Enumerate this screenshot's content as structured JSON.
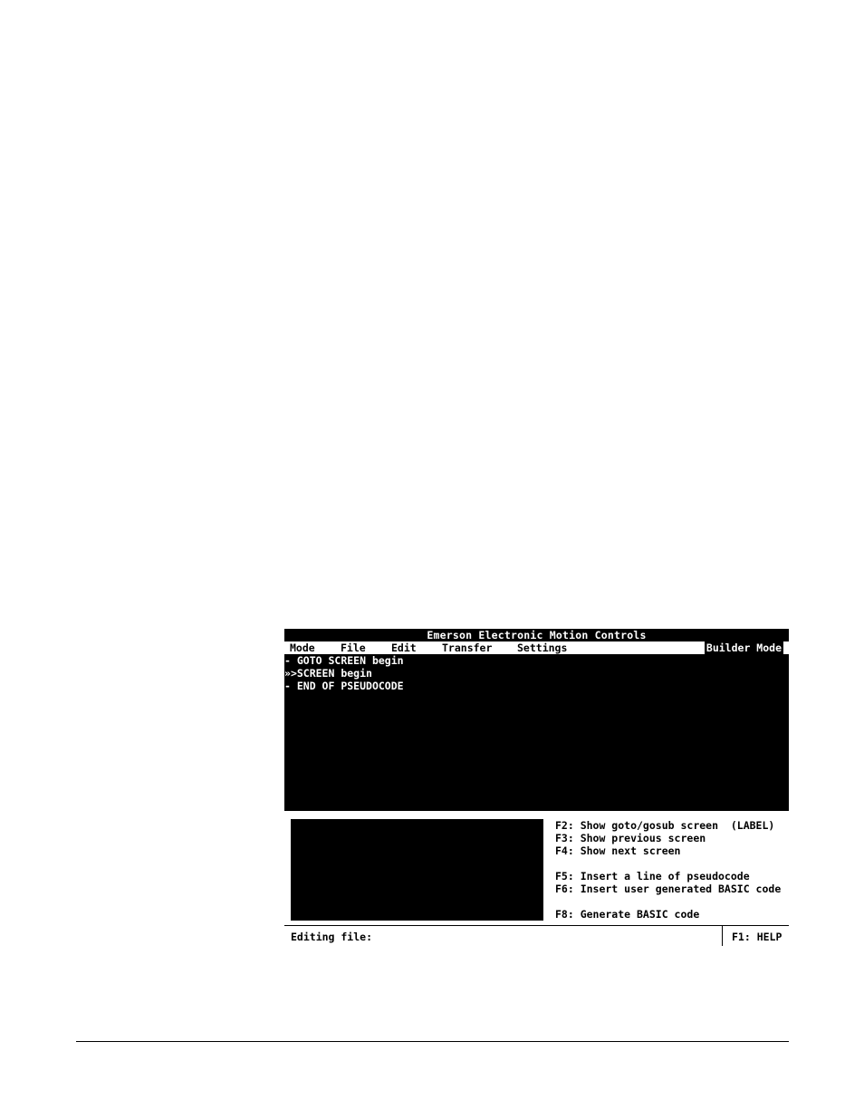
{
  "window": {
    "title": "Emerson Electronic Motion Controls"
  },
  "menu": {
    "items": [
      "Mode",
      "File",
      "Edit",
      "Transfer",
      "Settings"
    ],
    "mode_label": "Builder Mode"
  },
  "editor": {
    "lines": [
      {
        "marker": "-",
        "text": " GOTO SCREEN begin"
      },
      {
        "marker": "»",
        "text": ">SCREEN begin"
      },
      {
        "marker": "-",
        "text": " END OF PSEUDOCODE"
      }
    ]
  },
  "help": {
    "keys": [
      "F2: Show goto/gosub screen  (LABEL)",
      "F3: Show previous screen",
      "F4: Show next screen",
      "",
      "F5: Insert a line of pseudocode",
      "F6: Insert user generated BASIC code",
      "",
      "F8: Generate BASIC code"
    ]
  },
  "status": {
    "editing_label": "Editing file:",
    "help_label": "F1: HELP"
  },
  "colors": {
    "screen_bg": "#000000",
    "text_on_dark": "#ffffff",
    "text_on_light": "#000000"
  }
}
